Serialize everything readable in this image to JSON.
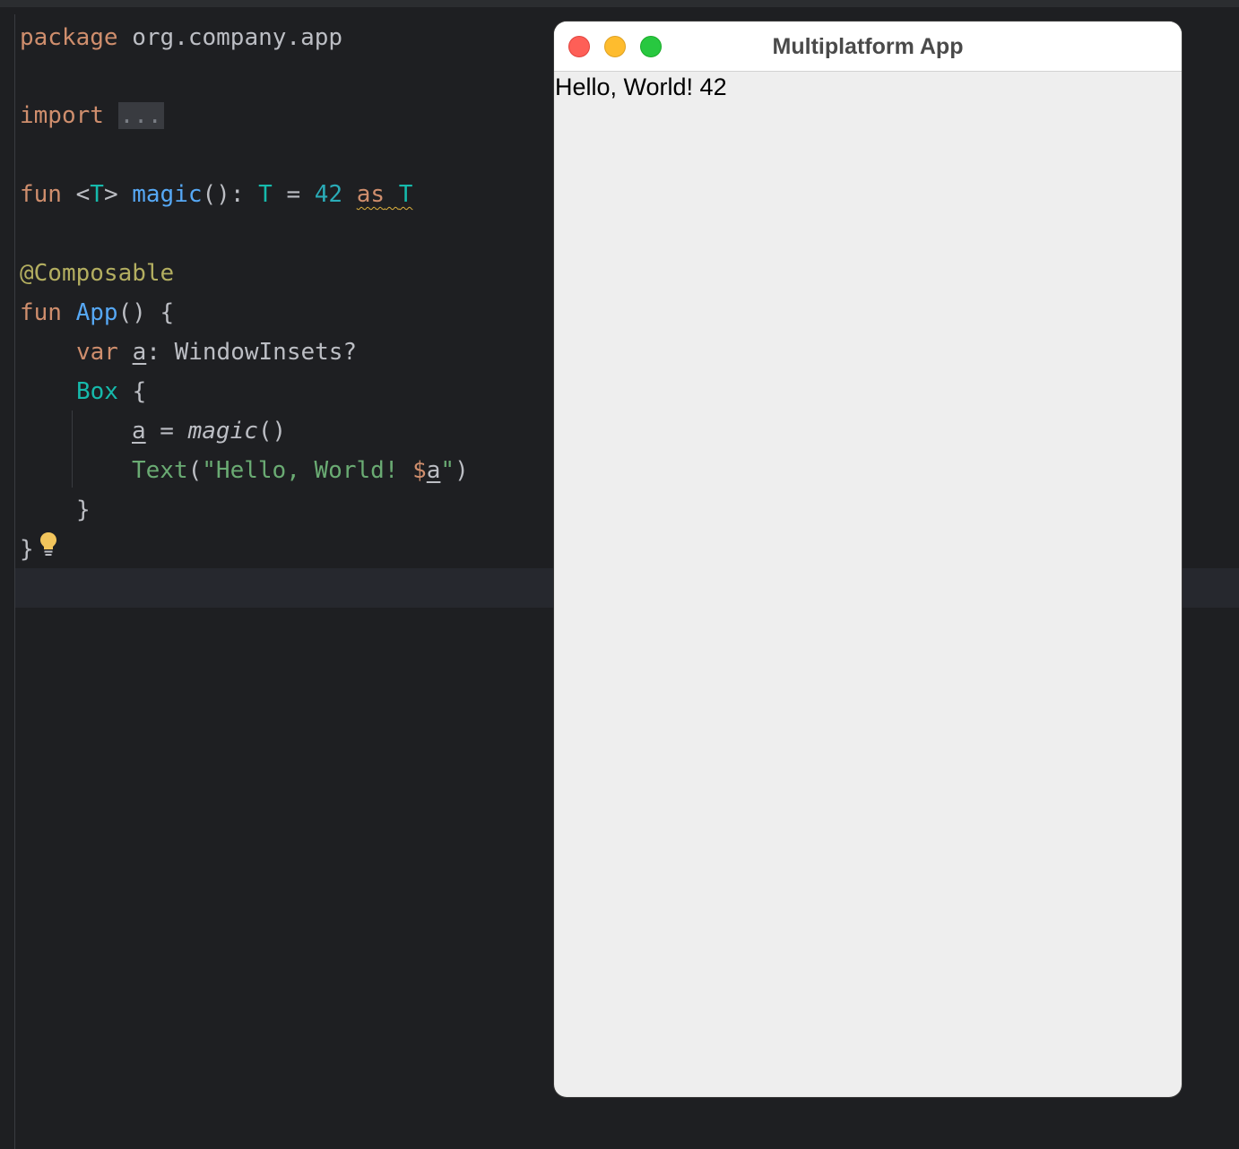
{
  "editor": {
    "tokens": {
      "package_kw": "package",
      "package_name": "org.company.app",
      "import_kw": "import",
      "import_fold": "...",
      "fun_kw": "fun",
      "type_param_open": "<",
      "type_param": "T",
      "type_param_close": ">",
      "magic_name": "magic",
      "magic_sig": "(): ",
      "ret_type": "T",
      "assign": " = ",
      "num_42": "42",
      "as_kw": "as",
      "cast_type": "T",
      "annotation": "@Composable",
      "fun_kw2": "fun",
      "app_name": "App",
      "app_sig": "() {",
      "var_kw": "var",
      "var_name": "a",
      "var_type": ": WindowInsets?",
      "box_name": "Box",
      "box_brace": " {",
      "assign_lhs": "a",
      "assign_eq": " = ",
      "magic_call": "magic",
      "magic_call_parens": "()",
      "text_call": "Text",
      "text_paren_open": "(",
      "text_string": "\"Hello, World! ",
      "text_dollar": "$",
      "text_var": "a",
      "text_quote": "\"",
      "text_paren_close": ")",
      "close_brace_inner": "}",
      "close_brace_outer": "}"
    }
  },
  "app_window": {
    "title": "Multiplatform App",
    "content_text": "Hello, World! 42"
  },
  "colors": {
    "keyword": "#cf8e6d",
    "function": "#56a8f5",
    "type": "#16baac",
    "number": "#2aacb8",
    "string": "#6aab73",
    "annotation": "#b3ae60",
    "editor_bg": "#1e1f22"
  },
  "icons": {
    "intention_bulb": "lightbulb-icon",
    "window_close": "close-icon",
    "window_minimize": "minimize-icon",
    "window_maximize": "maximize-icon"
  }
}
